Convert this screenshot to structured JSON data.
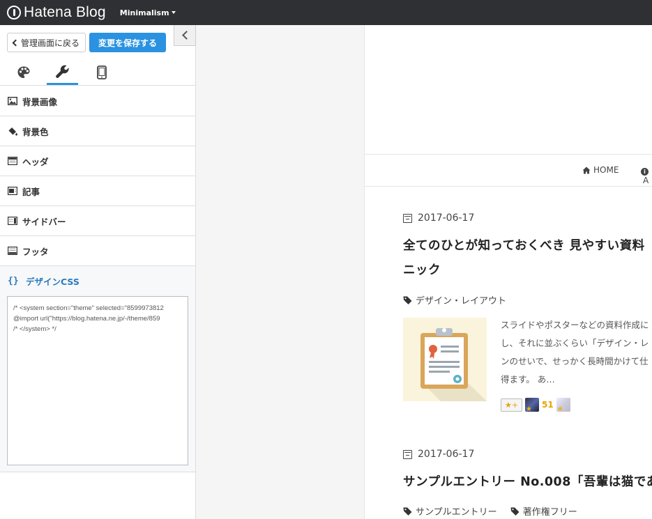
{
  "topbar": {
    "brand": "Hatena Blog",
    "theme": "Minimalism"
  },
  "panel": {
    "back_label": "管理画面に戻る",
    "save_label": "変更を保存する",
    "menu": [
      {
        "label": "背景画像",
        "icon": "image-icon"
      },
      {
        "label": "背景色",
        "icon": "paint-bucket-icon"
      },
      {
        "label": "ヘッダ",
        "icon": "header-layout-icon"
      },
      {
        "label": "記事",
        "icon": "article-layout-icon"
      },
      {
        "label": "サイドバー",
        "icon": "sidebar-layout-icon"
      },
      {
        "label": "フッタ",
        "icon": "footer-layout-icon"
      },
      {
        "label": "デザインCSS",
        "icon": "braces-icon"
      }
    ],
    "css_code": "/* <system section=\"theme\" selected=\"8599973812\n@import url(\"https://blog.hatena.ne.jp/-/theme/859\n/* </system> */"
  },
  "preview": {
    "nav": {
      "home": "HOME",
      "about": "A"
    },
    "entries": [
      {
        "date": "2017-06-17",
        "title_line1": "全てのひとが知っておくべき 見やすい資料",
        "title_line2": "ニック",
        "tags": [
          "デザイン・レイアウト"
        ],
        "excerpt": [
          "スライドやポスターなどの資料作成に",
          "し、それに並ぶくらい「デザイン・レ",
          "ンのせいで、せっかく長時間かけて仕",
          "得ます。 あ…"
        ],
        "star_count": "51"
      },
      {
        "date": "2017-06-17",
        "title_line1": "サンプルエントリー No.008「吾輩は猫であ",
        "tags": [
          "サンプルエントリー",
          "著作権フリー"
        ]
      }
    ]
  }
}
